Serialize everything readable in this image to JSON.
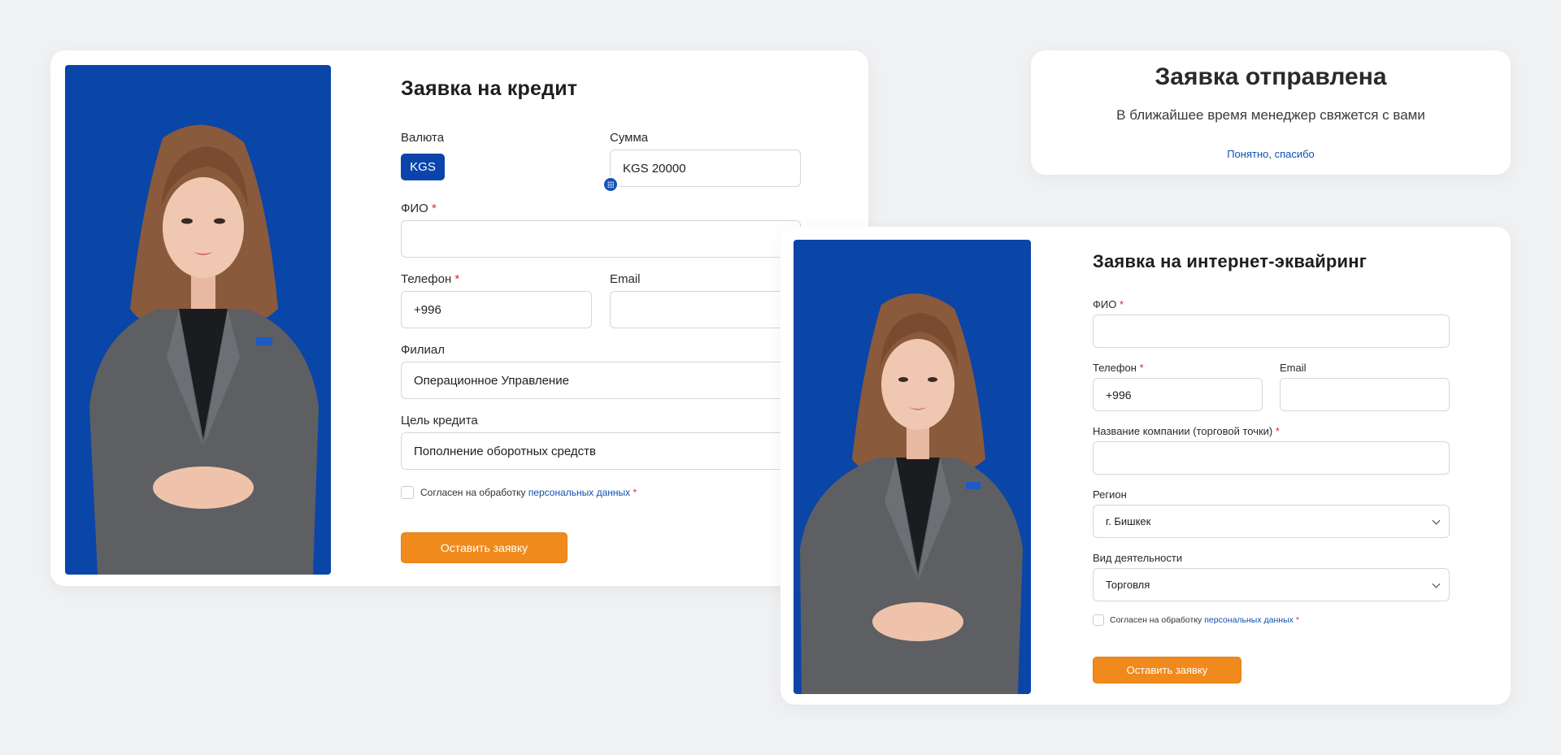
{
  "credit_form": {
    "title": "Заявка на кредит",
    "currency_label": "Валюта",
    "currency_value": "KGS",
    "amount_label": "Сумма",
    "amount_value": "KGS 20000",
    "fio_label": "ФИО",
    "required_mark": "*",
    "phone_label": "Телефон",
    "phone_value": "+996",
    "email_label": "Email",
    "email_value": "",
    "branch_label": "Филиал",
    "branch_value": "Операционное Управление",
    "purpose_label": "Цель кредита",
    "purpose_value": "Пополнение оборотных средств",
    "consent_text": "Согласен на обработку",
    "consent_link": "персональных данных",
    "submit_label": "Оставить заявку"
  },
  "success_card": {
    "title": "Заявка отправлена",
    "message": "В ближайшее время менеджер свяжется с вами",
    "action": "Понятно, спасибо"
  },
  "acquiring_form": {
    "title": "Заявка на интернет-эквайринг",
    "fio_label": "ФИО",
    "required_mark": "*",
    "phone_label": "Телефон",
    "phone_value": "+996",
    "email_label": "Email",
    "company_label": "Название компании (торговой точки)",
    "region_label": "Регион",
    "region_value": "г. Бишкек",
    "activity_label": "Вид деятельности",
    "activity_value": "Торговля",
    "consent_text": "Согласен на обработку",
    "consent_link": "персональных данных",
    "submit_label": "Оставить заявку"
  },
  "colors": {
    "brand_blue": "#0a45a8",
    "accent_orange": "#f08a1c",
    "link_blue": "#1150b0",
    "required_red": "#d0312d"
  }
}
